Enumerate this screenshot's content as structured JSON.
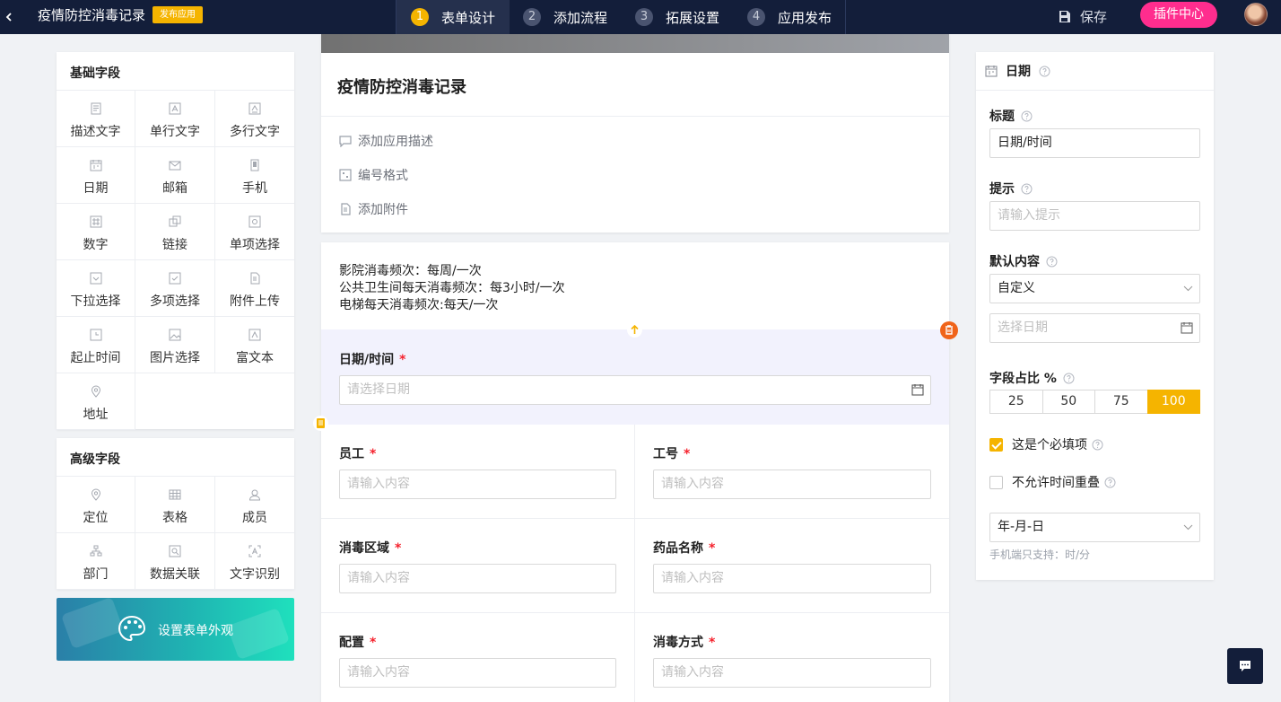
{
  "header": {
    "app_title": "疫情防控消毒记录",
    "publish_badge": "发布应用",
    "steps": [
      {
        "num": "1",
        "label": "表单设计",
        "active": true
      },
      {
        "num": "2",
        "label": "添加流程"
      },
      {
        "num": "3",
        "label": "拓展设置"
      },
      {
        "num": "4",
        "label": "应用发布"
      }
    ],
    "save_label": "保存",
    "plugin_label": "插件中心"
  },
  "basic_fields": {
    "title": "基础字段",
    "items": [
      {
        "label": "描述文字",
        "icon": "document-icon"
      },
      {
        "label": "单行文字",
        "icon": "single-line-icon"
      },
      {
        "label": "多行文字",
        "icon": "multi-line-icon"
      },
      {
        "label": "日期",
        "icon": "calendar-icon"
      },
      {
        "label": "邮箱",
        "icon": "mail-icon"
      },
      {
        "label": "手机",
        "icon": "phone-icon"
      },
      {
        "label": "数字",
        "icon": "number-icon"
      },
      {
        "label": "链接",
        "icon": "link-icon"
      },
      {
        "label": "单项选择",
        "icon": "radio-icon"
      },
      {
        "label": "下拉选择",
        "icon": "dropdown-icon"
      },
      {
        "label": "多项选择",
        "icon": "checkbox-icon"
      },
      {
        "label": "附件上传",
        "icon": "attachment-icon"
      },
      {
        "label": "起止时间",
        "icon": "time-range-icon"
      },
      {
        "label": "图片选择",
        "icon": "image-icon"
      },
      {
        "label": "富文本",
        "icon": "rich-text-icon"
      },
      {
        "label": "地址",
        "icon": "location-icon"
      }
    ]
  },
  "advanced_fields": {
    "title": "高级字段",
    "items": [
      {
        "label": "定位",
        "icon": "location-pin-icon"
      },
      {
        "label": "表格",
        "icon": "table-icon"
      },
      {
        "label": "成员",
        "icon": "member-icon"
      },
      {
        "label": "部门",
        "icon": "department-icon"
      },
      {
        "label": "数据关联",
        "icon": "data-link-icon"
      },
      {
        "label": "文字识别",
        "icon": "ocr-icon"
      }
    ]
  },
  "appearance": {
    "label": "设置表单外观",
    "icon": "palette-icon"
  },
  "form": {
    "title": "疫情防控消毒记录",
    "actions": [
      "添加应用描述",
      "编号格式",
      "添加附件"
    ],
    "description": [
      "影院消毒频次：每周/一次",
      "公共卫生间每天消毒频次：每3小时/一次",
      "电梯每天消毒频次:每天/一次"
    ],
    "date_field": {
      "label": "日期/时间",
      "placeholder": "请选择日期"
    },
    "rows": [
      [
        {
          "label": "员工",
          "placeholder": "请输入内容"
        },
        {
          "label": "工号",
          "placeholder": "请输入内容"
        }
      ],
      [
        {
          "label": "消毒区域",
          "placeholder": "请输入内容"
        },
        {
          "label": "药品名称",
          "placeholder": "请输入内容"
        }
      ],
      [
        {
          "label": "配置",
          "placeholder": "请输入内容"
        },
        {
          "label": "消毒方式",
          "placeholder": "请输入内容"
        }
      ]
    ],
    "required_mark": "*"
  },
  "props": {
    "header": "日期",
    "title_label": "标题",
    "title_value": "日期/时间",
    "hint_label": "提示",
    "hint_placeholder": "请输入提示",
    "default_label": "默认内容",
    "default_value": "自定义",
    "date_placeholder": "选择日期",
    "ratio_label": "字段占比 %",
    "ratio_options": [
      "25",
      "50",
      "75",
      "100"
    ],
    "ratio_selected": "100",
    "required_label": "这是个必填项",
    "required_checked": true,
    "no_overlap_label": "不允许时间重叠",
    "no_overlap_checked": false,
    "format_value": "年-月-日",
    "mobile_hint": "手机端只支持：时/分"
  },
  "colors": {
    "accent": "#f5b400",
    "topbar": "#131e3a",
    "plugin": "#ff2d8e",
    "required": "#f5222d",
    "delete": "#f0641a"
  }
}
